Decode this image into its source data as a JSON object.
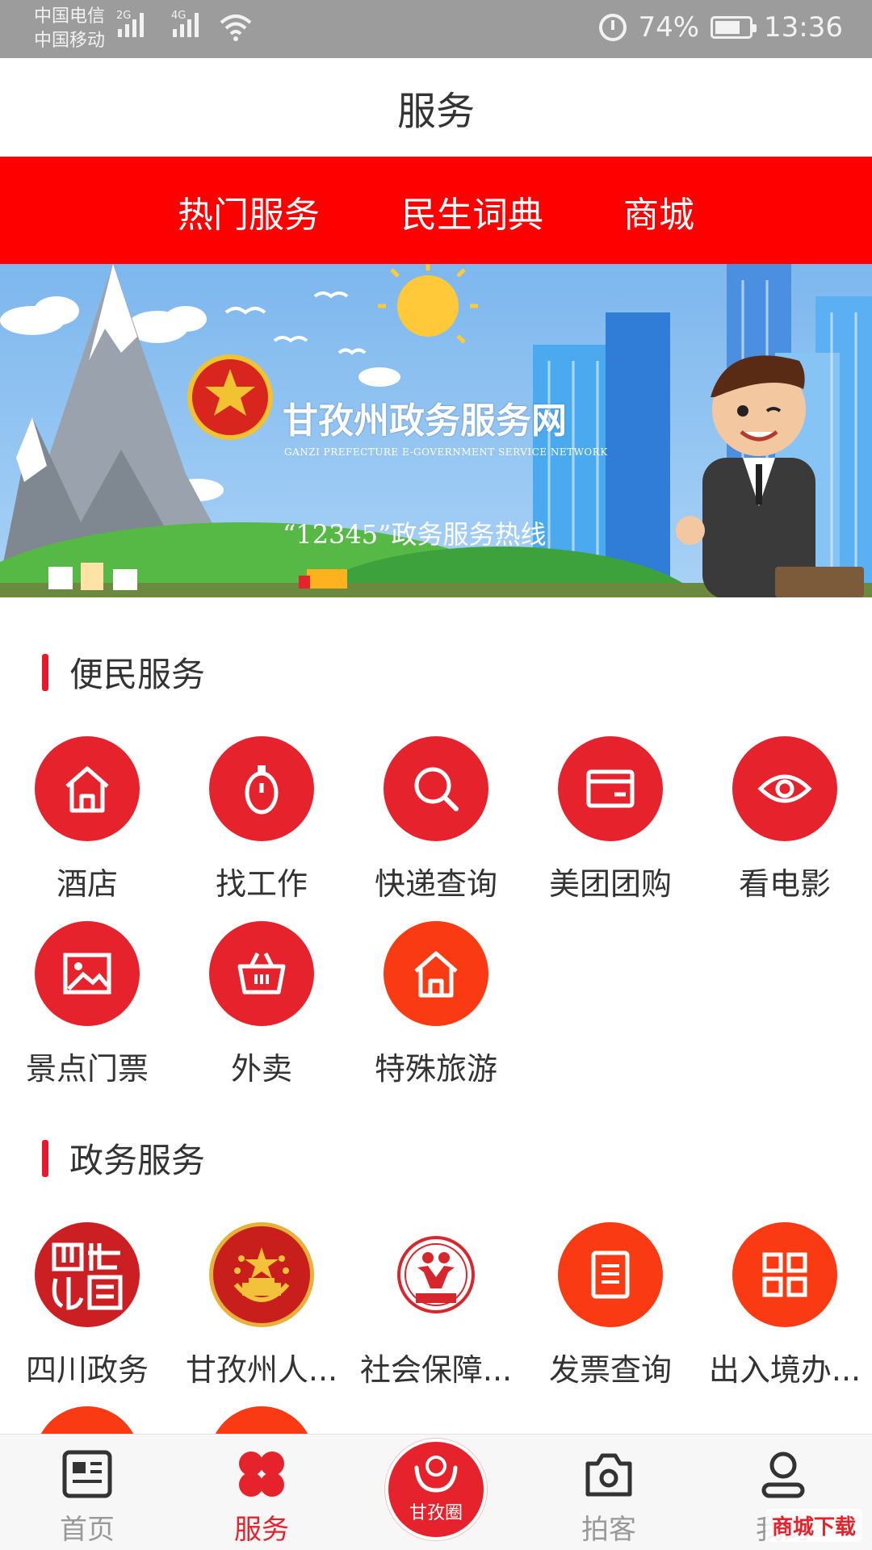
{
  "status_bar": {
    "carrier1": "中国电信",
    "carrier2": "中国移动",
    "net1": "2G",
    "net2": "4G",
    "battery_percent": "74%",
    "battery_level": 0.74,
    "time": "13:36"
  },
  "header": {
    "title": "服务"
  },
  "tabs": [
    {
      "label": "热门服务"
    },
    {
      "label": "民生词典"
    },
    {
      "label": "商城"
    }
  ],
  "banner": {
    "title": "甘孜州政务服务网",
    "subtitle": "GANZI PREFECTURE E-GOVERNMENT SERVICE NETWORK",
    "hotline": "“12345”政务服务热线"
  },
  "sections": {
    "convenience": {
      "title": "便民服务",
      "items": [
        {
          "label": "酒店",
          "icon": "house-icon"
        },
        {
          "label": "找工作",
          "icon": "timer-icon"
        },
        {
          "label": "快递查询",
          "icon": "search-icon"
        },
        {
          "label": "美团团购",
          "icon": "card-icon"
        },
        {
          "label": "看电影",
          "icon": "eye-icon"
        },
        {
          "label": "景点门票",
          "icon": "image-icon"
        },
        {
          "label": "外卖",
          "icon": "basket-icon"
        },
        {
          "label": "特殊旅游",
          "icon": "house-icon"
        }
      ]
    },
    "government": {
      "title": "政务服务",
      "items": [
        {
          "label": "四川政务",
          "icon": "sichuan-seal-icon"
        },
        {
          "label": "甘孜州人...",
          "icon": "national-emblem-icon"
        },
        {
          "label": "社会保障...",
          "icon": "social-security-logo-icon"
        },
        {
          "label": "发票查询",
          "icon": "document-icon"
        },
        {
          "label": "出入境办...",
          "icon": "grid-icon"
        }
      ]
    }
  },
  "bottom_nav": {
    "items": [
      {
        "label": "首页",
        "icon": "news-icon"
      },
      {
        "label": "服务",
        "icon": "clover-icon"
      },
      {
        "label": "拍客",
        "icon": "camera-icon"
      },
      {
        "label": "我的",
        "icon": "user-icon"
      }
    ],
    "center": {
      "label": "甘孜圈",
      "icon": "hands-icon"
    }
  },
  "watermark": "商城下载"
}
